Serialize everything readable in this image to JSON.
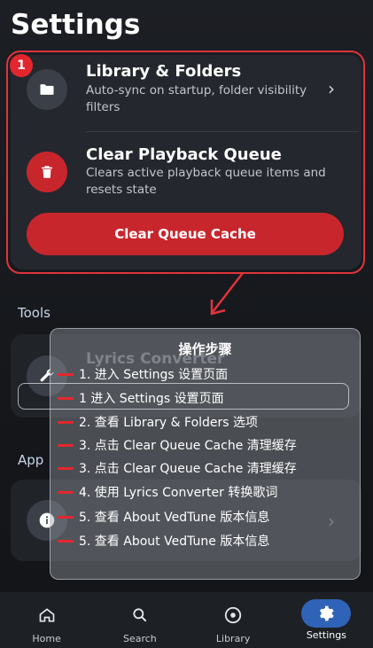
{
  "page": {
    "title": "Settings"
  },
  "storage_card": {
    "badge": "1",
    "library": {
      "title": "Library & Folders",
      "subtitle": "Auto-sync on startup, folder visibility filters",
      "icon": "folder-icon",
      "chevron": "›"
    },
    "clear_queue": {
      "title": "Clear Playback Queue",
      "subtitle": "Clears active playback queue items and resets state",
      "icon": "trash-icon"
    },
    "button_label": "Clear Queue Cache"
  },
  "tools": {
    "label": "Tools",
    "item_title": "Lyrics Converter",
    "icon": "wrench-icon"
  },
  "app": {
    "label": "App",
    "icon": "info-icon",
    "chevron": "›"
  },
  "overlay": {
    "title": "操作步骤",
    "steps": [
      "1. 进入 Settings 设置页面",
      "1  进入  Settings 设置页面",
      "2. 查看 Library & Folders 选项",
      "3. 点击 Clear Queue Cache 清理缓存",
      "3. 点击 Clear Queue Cache 清理缓存",
      "4. 使用 Lyrics Converter 转换歌词",
      "5. 查看 About VedTune 版本信息",
      "5. 查看 About VedTune 版本信息"
    ]
  },
  "bottom_nav": {
    "items": [
      {
        "label": "Home",
        "icon": "home-icon"
      },
      {
        "label": "Search",
        "icon": "search-icon"
      },
      {
        "label": "Library",
        "icon": "library-disc-icon"
      },
      {
        "label": "Settings",
        "icon": "gear-icon",
        "active": true
      }
    ]
  },
  "colors": {
    "accent_red": "#c8262d",
    "highlight_red": "#e0343a",
    "active_nav": "#2f63b8"
  }
}
